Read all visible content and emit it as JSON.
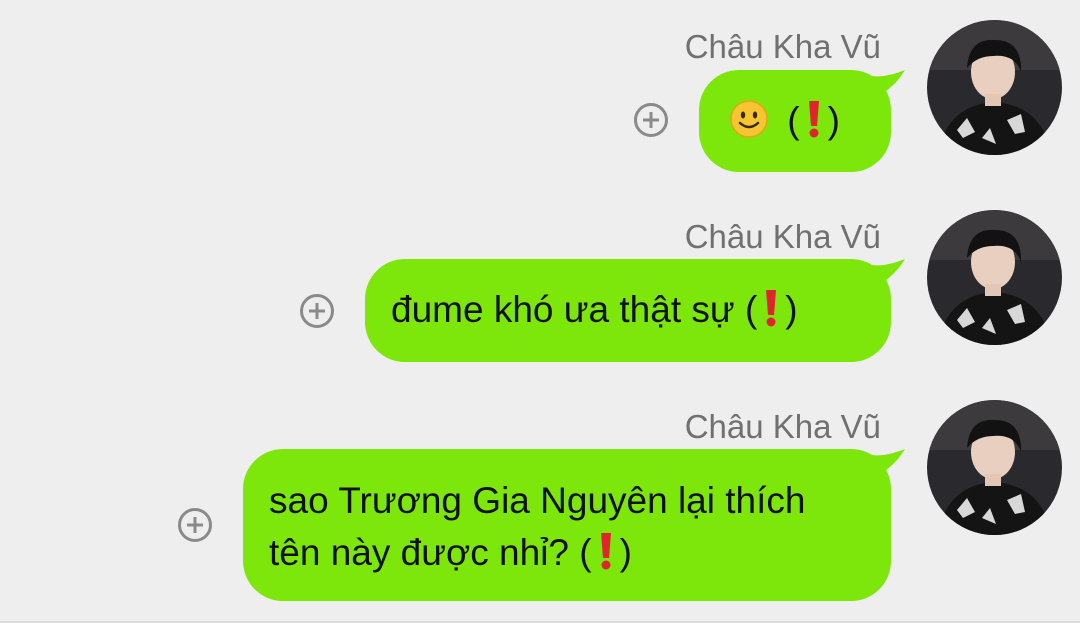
{
  "conversation": {
    "messages": [
      {
        "sender": "Châu Kha Vũ",
        "text_before": "",
        "text_after": "(",
        "text_close": ")",
        "icons": [
          "slightly-smiling-face-icon",
          "red-exclamation-icon"
        ]
      },
      {
        "sender": "Châu Kha Vũ",
        "text_before": "đume khó ưa thật sự (",
        "text_close": ")",
        "icons": [
          "red-exclamation-icon"
        ]
      },
      {
        "sender": "Châu Kha Vũ",
        "line1": "sao Trương Gia Nguyên lại thích",
        "line2_before": "tên này được nhỉ? (",
        "text_close": ")",
        "icons": [
          "red-exclamation-icon"
        ]
      }
    ]
  },
  "colors": {
    "bubble": "#7de60a",
    "background": "#eeeeee",
    "sender_name": "#707070",
    "add_icon": "#8a8a8a"
  }
}
